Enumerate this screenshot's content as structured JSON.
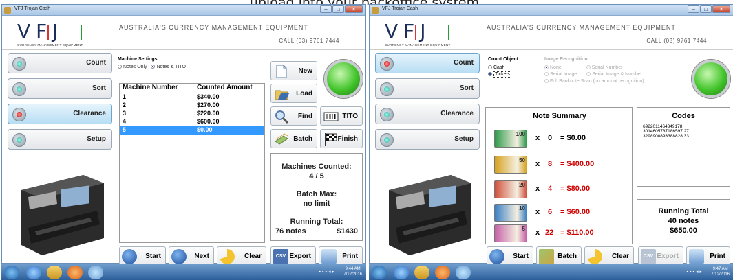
{
  "caption": "upload into your backoffice system.",
  "windows": [
    {
      "title": "VFJ Trojan Cash",
      "logo": "VFJ",
      "logo_sub": "CURRENCY MANAGEMENT EQUIPMENT",
      "tagline": "AUSTRALIA'S CURRENCY MANAGEMENT EQUIPMENT",
      "phone": "CALL (03) 9761 7444",
      "menu": [
        "Count",
        "Sort",
        "Clearance",
        "Setup"
      ],
      "settings": {
        "title": "Machine Settings",
        "opt1": "Notes Only",
        "opt2": "Notes & TITO"
      },
      "table": {
        "headers": [
          "Machine Number",
          "Counted Amount"
        ],
        "rows": [
          [
            "1",
            "$340.00"
          ],
          [
            "2",
            "$270.00"
          ],
          [
            "3",
            "$220.00"
          ],
          [
            "4",
            "$600.00"
          ],
          [
            "5",
            "$0.00"
          ]
        ]
      },
      "actions": {
        "new": "New",
        "load": "Load",
        "find": "Find",
        "tito": "TITO",
        "batch": "Batch",
        "finish": "Finish"
      },
      "status": {
        "machines_label": "Machines Counted:",
        "machines_value": "4 / 5",
        "batch_label": "Batch Max:",
        "batch_value": "no limit",
        "running_label": "Running Total:",
        "running_notes": "76 notes",
        "running_amount": "$1430"
      },
      "bottom": {
        "start": "Start",
        "next": "Next",
        "clear": "Clear",
        "export": "Export",
        "print": "Print"
      },
      "clock": {
        "time": "9:44 AM",
        "date": "7/12/2016"
      }
    },
    {
      "title": "VFJ Trojan Cash",
      "logo": "VFJ",
      "logo_sub": "CURRENCY MANAGEMENT EQUIPMENT",
      "tagline": "AUSTRALIA'S CURRENCY MANAGEMENT EQUIPMENT",
      "phone": "CALL (03) 9761 7444",
      "menu": [
        "Count",
        "Sort",
        "Clearance",
        "Setup"
      ],
      "count_object": {
        "title": "Count Object",
        "cash": "Cash",
        "tickets": "Tickets"
      },
      "image_recognition": {
        "title": "Image Recognition",
        "none": "None",
        "serial_number": "Serial Number",
        "serial_image": "Serial Image",
        "serial_image_number": "Serial Image & Number",
        "full_scan": "Full Banknote Scan (no amount recognition)"
      },
      "summary": {
        "title": "Note Summary",
        "rows": [
          {
            "denom": "100",
            "qty": "0",
            "amount": "= $0.00",
            "color": "#2e9a4a"
          },
          {
            "denom": "50",
            "qty": "8",
            "amount": "= $400.00",
            "color": "#d6a21f"
          },
          {
            "denom": "20",
            "qty": "4",
            "amount": "= $80.00",
            "color": "#d0503c"
          },
          {
            "denom": "10",
            "qty": "6",
            "amount": "= $60.00",
            "color": "#3a7fc4"
          },
          {
            "denom": "5",
            "qty": "22",
            "amount": "= $110.00",
            "color": "#c561a8"
          }
        ],
        "x": "x"
      },
      "codes": {
        "title": "Codes",
        "list": [
          "6922011464349178",
          "3014605737186597 27",
          "3298900893388828 33"
        ]
      },
      "running": {
        "title": "Running Total",
        "notes": "40 notes",
        "amount": "$650.00"
      },
      "bottom": {
        "start": "Start",
        "batch": "Batch",
        "clear": "Clear",
        "export": "Export",
        "print": "Print"
      },
      "clock": {
        "time": "9:47 AM",
        "date": "7/12/2016"
      }
    }
  ]
}
